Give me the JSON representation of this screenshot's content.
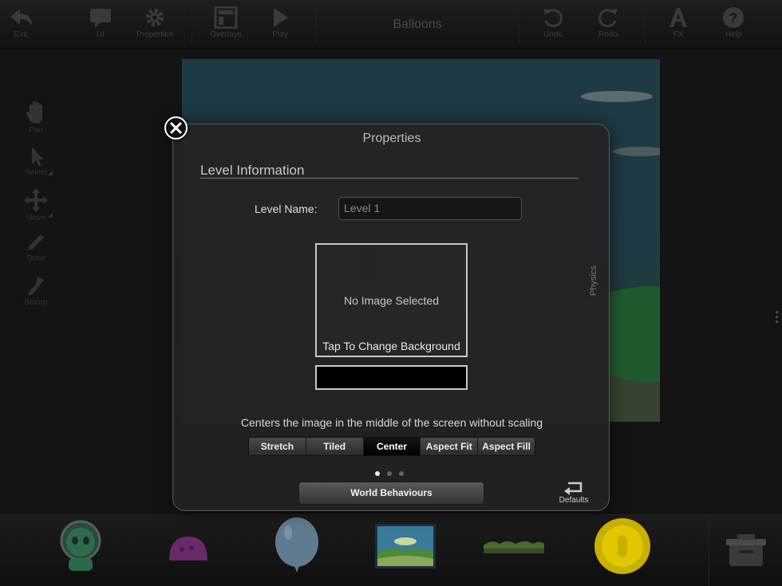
{
  "toolbar": {
    "items": [
      {
        "label": "Exit",
        "icon": "back-arrow-icon"
      },
      {
        "label": "UI",
        "icon": "speech-bubble-icon"
      },
      {
        "label": "Properties",
        "icon": "gear-icon"
      },
      {
        "label": "Overlays",
        "icon": "overlays-icon"
      },
      {
        "label": "Play",
        "icon": "play-icon"
      },
      {
        "label": "Undo",
        "icon": "undo-icon"
      },
      {
        "label": "Redo",
        "icon": "redo-icon"
      },
      {
        "label": "FX",
        "icon": "fx-icon"
      },
      {
        "label": "Help",
        "icon": "help-icon"
      }
    ],
    "title": "Balloons"
  },
  "tools": [
    {
      "label": "Pan",
      "icon": "hand-icon"
    },
    {
      "label": "Select",
      "icon": "pointer-icon"
    },
    {
      "label": "Move",
      "icon": "move-arrows-icon"
    },
    {
      "label": "Draw",
      "icon": "pencil-icon"
    },
    {
      "label": "Stamp",
      "icon": "stamp-icon"
    }
  ],
  "dialog": {
    "title": "Properties",
    "section_title": "Level Information",
    "level_name_label": "Level Name:",
    "level_name_value": "Level 1",
    "no_image_text": "No Image Selected",
    "tap_change_text": "Tap To Change Background",
    "scale_description": "Centers the image in the middle of the screen without scaling",
    "scale_modes": [
      "Stretch",
      "Tiled",
      "Center",
      "Aspect Fit",
      "Aspect Fill"
    ],
    "selected_scale_mode": "Center",
    "page_indicator": {
      "count": 3,
      "current": 1
    },
    "world_behaviours_label": "World Behaviours",
    "defaults_label": "Defaults",
    "side_tab_label": "Physics"
  },
  "tray": {
    "items": [
      {
        "icon": "alien-character-icon"
      },
      {
        "icon": "pink-dome-icon"
      },
      {
        "icon": "balloon-icon"
      },
      {
        "icon": "background-scene-icon"
      },
      {
        "icon": "grass-platform-icon"
      },
      {
        "icon": "gold-coin-icon"
      },
      {
        "icon": "trash-tray-icon"
      }
    ]
  },
  "colors": {
    "background": "#141414",
    "dialog_bg": "#222222",
    "active_segment": "#000000",
    "coin": "#e1c700",
    "balloon": "#607a90"
  }
}
